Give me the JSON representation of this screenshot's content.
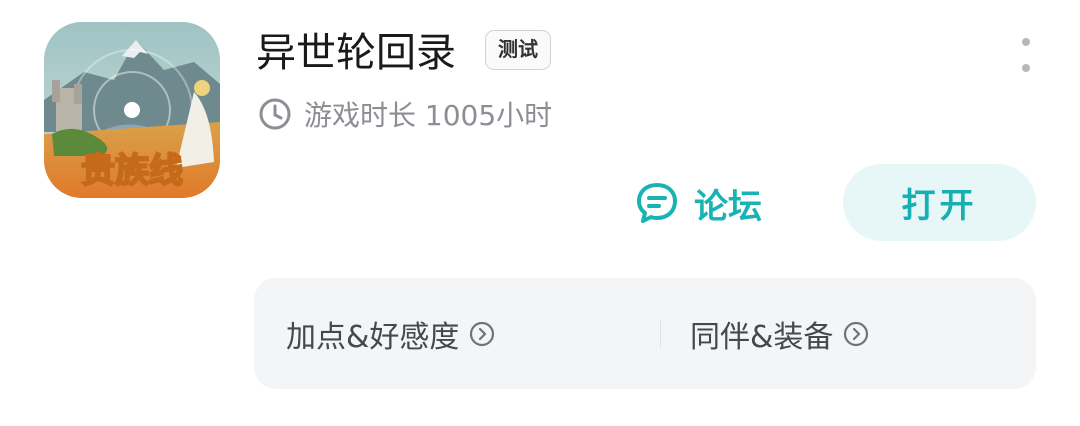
{
  "app": {
    "title": "异世轮回录",
    "badge": "测试",
    "icon_name": "game-cover-icon",
    "icon_text": "贵族线"
  },
  "playtime": {
    "icon": "clock-icon",
    "text": "游戏时长 1005小时"
  },
  "actions": {
    "forum_label": "论坛",
    "forum_icon": "chat-bubble-icon",
    "open_label": "打开"
  },
  "links": [
    {
      "label": "加点&好感度",
      "icon": "chevron-right-circle-icon"
    },
    {
      "label": "同伴&装备",
      "icon": "chevron-right-circle-icon"
    }
  ],
  "colors": {
    "accent": "#19b3b3",
    "open_bg": "#e7f7f8",
    "card_bg": "#f4f5f7",
    "muted_text": "#8b8f94"
  }
}
